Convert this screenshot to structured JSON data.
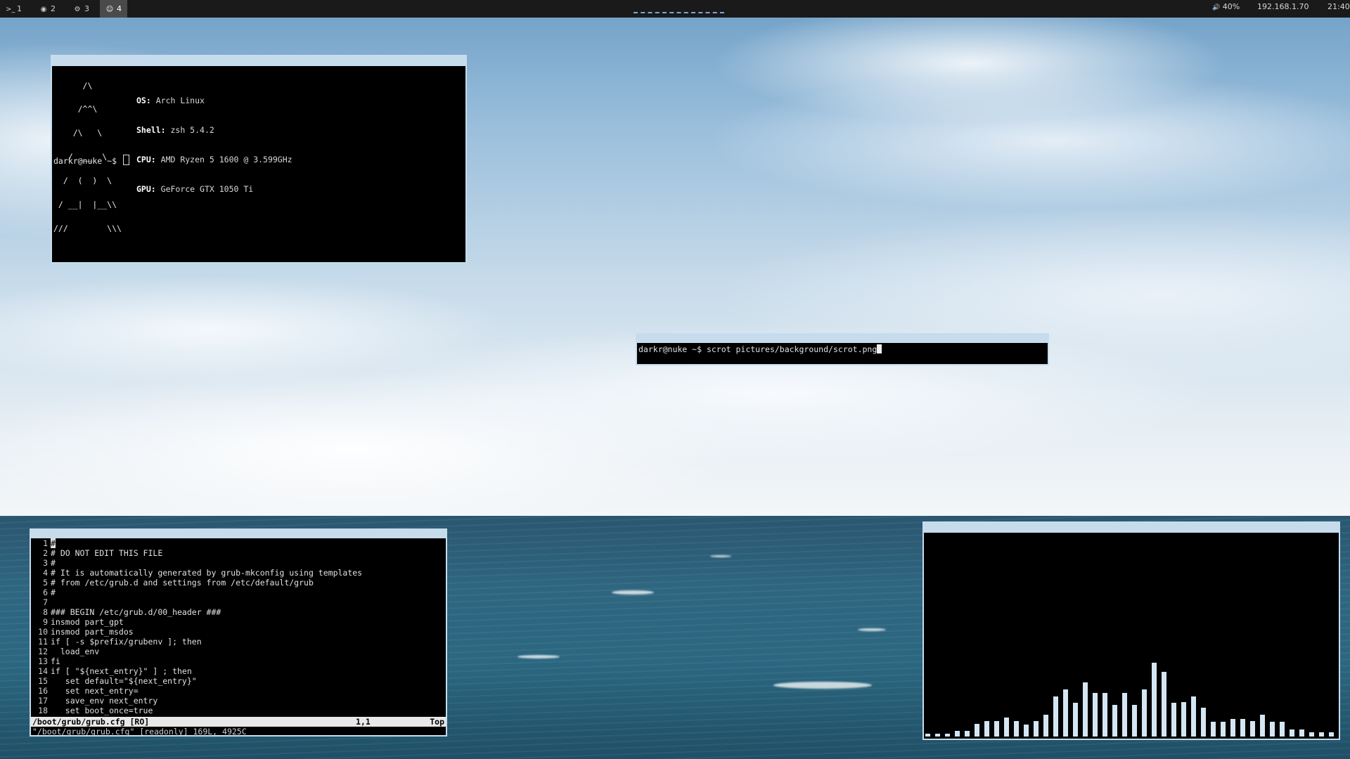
{
  "topbar": {
    "workspaces": [
      {
        "icon": "terminal-icon",
        "glyph": ">_",
        "label": "1",
        "active": false
      },
      {
        "icon": "chrome-icon",
        "glyph": "◉",
        "label": "2",
        "active": false
      },
      {
        "icon": "steam-icon",
        "glyph": "⚙",
        "label": "3",
        "active": false
      },
      {
        "icon": "discord-icon",
        "glyph": "☺",
        "label": "4",
        "active": true
      }
    ],
    "volume": {
      "icon": "speaker-icon",
      "glyph": "🔊",
      "text": "40%"
    },
    "ip": "192.168.1.70",
    "clock": "21:40",
    "accent": "#7aa8d8"
  },
  "fetch": {
    "ascii": [
      "      /\\",
      "     /^^\\",
      "    /\\   \\",
      "   /  __  \\",
      "  /  (  )  \\",
      " / __|  |__\\\\",
      "///        \\\\\\"
    ],
    "info": [
      {
        "key": "OS:",
        "value": "Arch Linux"
      },
      {
        "key": "Shell:",
        "value": "zsh 5.4.2"
      },
      {
        "key": "CPU:",
        "value": "AMD Ryzen 5 1600 @ 3.599GHz"
      },
      {
        "key": "GPU:",
        "value": "GeForce GTX 1050 Ti"
      }
    ],
    "prompt": "darkr@nuke ~$ "
  },
  "scrot": {
    "prompt": "darkr@nuke ~$ ",
    "command": "scrot pictures/background/scrot.png"
  },
  "vim": {
    "lines": [
      {
        "n": "1",
        "t": "#",
        "cursor": true
      },
      {
        "n": "2",
        "t": "# DO NOT EDIT THIS FILE"
      },
      {
        "n": "3",
        "t": "#"
      },
      {
        "n": "4",
        "t": "# It is automatically generated by grub-mkconfig using templates"
      },
      {
        "n": "5",
        "t": "# from /etc/grub.d and settings from /etc/default/grub"
      },
      {
        "n": "6",
        "t": "#"
      },
      {
        "n": "7",
        "t": ""
      },
      {
        "n": "8",
        "t": "### BEGIN /etc/grub.d/00_header ###"
      },
      {
        "n": "9",
        "t": "insmod part_gpt"
      },
      {
        "n": "10",
        "t": "insmod part_msdos"
      },
      {
        "n": "11",
        "t": "if [ -s $prefix/grubenv ]; then"
      },
      {
        "n": "12",
        "t": "  load_env"
      },
      {
        "n": "13",
        "t": "fi"
      },
      {
        "n": "14",
        "t": "if [ \"${next_entry}\" ] ; then"
      },
      {
        "n": "15",
        "t": "   set default=\"${next_entry}\""
      },
      {
        "n": "16",
        "t": "   set next_entry="
      },
      {
        "n": "17",
        "t": "   save_env next_entry"
      },
      {
        "n": "18",
        "t": "   set boot_once=true"
      }
    ],
    "status_file": "/boot/grub/grub.cfg [RO]",
    "status_pos": "1,1",
    "status_pct": "Top",
    "message": "\"/boot/grub/grub.cfg\" [readonly] 169L, 4925C"
  },
  "visualizer": {
    "bar_color": "#d4e6f3",
    "levels": [
      0.03,
      0.03,
      0.03,
      0.06,
      0.06,
      0.13,
      0.16,
      0.16,
      0.19,
      0.16,
      0.12,
      0.16,
      0.22,
      0.41,
      0.48,
      0.34,
      0.55,
      0.44,
      0.44,
      0.32,
      0.44,
      0.32,
      0.48,
      0.75,
      0.66,
      0.34,
      0.35,
      0.41,
      0.29,
      0.15,
      0.15,
      0.18,
      0.18,
      0.16,
      0.22,
      0.15,
      0.15,
      0.07,
      0.07,
      0.04,
      0.04,
      0.04
    ]
  }
}
